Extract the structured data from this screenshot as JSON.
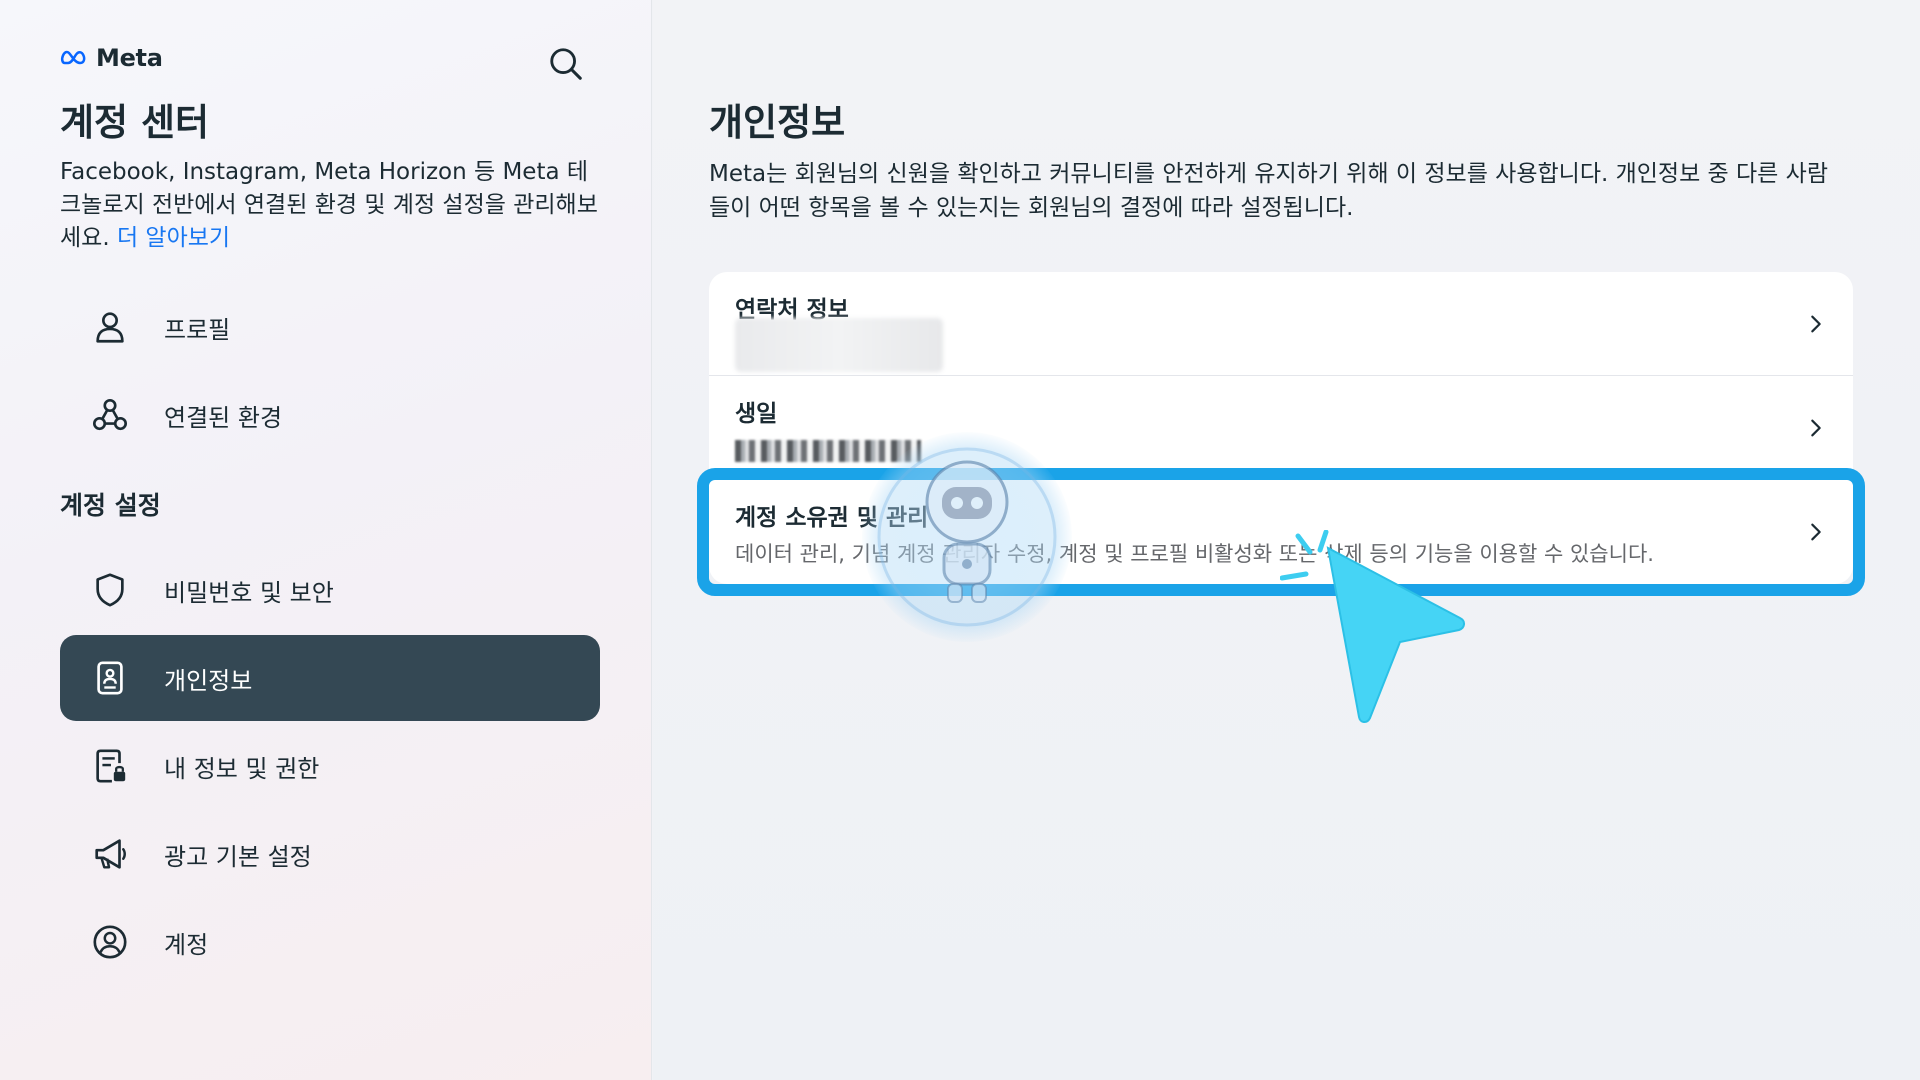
{
  "sidebar": {
    "brand": "Meta",
    "title": "계정 센터",
    "description": "Facebook, Instagram, Meta Horizon 등 Meta 테크놀로지 전반에서 연결된 환경 및 계정 설정을 관리해보세요.",
    "learn_more": "더 알아보기",
    "top_items": [
      {
        "label": "프로필",
        "icon": "person-icon"
      },
      {
        "label": "연결된 환경",
        "icon": "connected-nodes-icon"
      }
    ],
    "section_label": "계정 설정",
    "settings_items": [
      {
        "label": "비밀번호 및 보안",
        "icon": "shield-icon"
      },
      {
        "label": "개인정보",
        "icon": "id-card-icon",
        "active": true
      },
      {
        "label": "내 정보 및 권한",
        "icon": "document-lock-icon"
      },
      {
        "label": "광고 기본 설정",
        "icon": "megaphone-icon"
      },
      {
        "label": "계정",
        "icon": "account-circle-icon"
      }
    ]
  },
  "main": {
    "title": "개인정보",
    "description": "Meta는 회원님의 신원을 확인하고 커뮤니티를 안전하게 유지하기 위해 이 정보를 사용합니다. 개인정보 중 다른 사람들이 어떤 항목을 볼 수 있는지는 회원님의 결정에 따라 설정됩니다.",
    "rows": [
      {
        "label": "연락처 정보",
        "value": ""
      },
      {
        "label": "생일",
        "value": ""
      },
      {
        "label": "계정 소유권 및 관리",
        "value": "데이터 관리, 기념 계정 관리자 수정, 계정 및 프로필 비활성화 또는 삭제 등의 기능을 이용할 수 있습니다."
      }
    ]
  },
  "colors": {
    "accent_link": "#1877f2",
    "active_nav_bg": "#344854",
    "highlight_outline": "#1aa3e8",
    "cursor": "#3dcdf0"
  }
}
